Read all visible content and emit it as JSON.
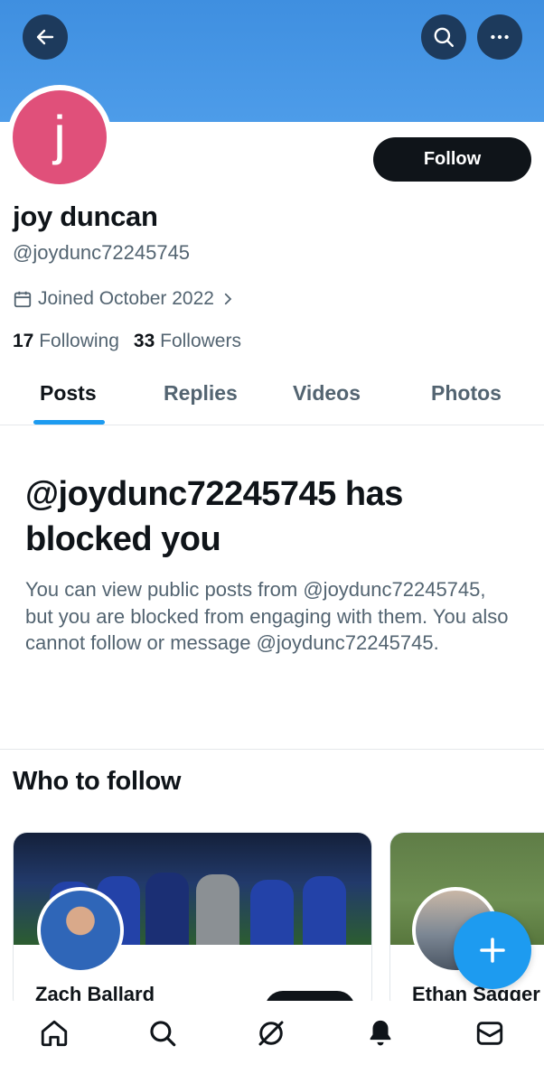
{
  "profile": {
    "avatar_letter": "j",
    "follow_label": "Follow",
    "name": "joy duncan",
    "handle": "@joydunc72245745",
    "joined": "Joined October 2022",
    "following_count": "17",
    "following_label": "Following",
    "followers_count": "33",
    "followers_label": "Followers"
  },
  "tabs": [
    {
      "label": "Posts",
      "active": true
    },
    {
      "label": "Replies",
      "active": false
    },
    {
      "label": "Videos",
      "active": false
    },
    {
      "label": "Photos",
      "active": false
    }
  ],
  "blocked": {
    "title": "@joydunc72245745 has blocked you",
    "message": "You can view public posts from @joydunc72245745, but you are blocked from engaging with them. You also cannot follow or message @joydunc72245745."
  },
  "who_to_follow": {
    "title": "Who to follow",
    "cards": [
      {
        "name": "Zach Ballard"
      },
      {
        "name": "Ethan Sagger"
      }
    ]
  },
  "nav": [
    "home-icon",
    "search-icon",
    "grok-icon",
    "notifications-icon",
    "messages-icon"
  ],
  "colors": {
    "banner": "#4a96e5",
    "avatar": "#e0507a",
    "accent": "#1d9bf0",
    "text": "#0f1419",
    "secondary_text": "#536471"
  }
}
